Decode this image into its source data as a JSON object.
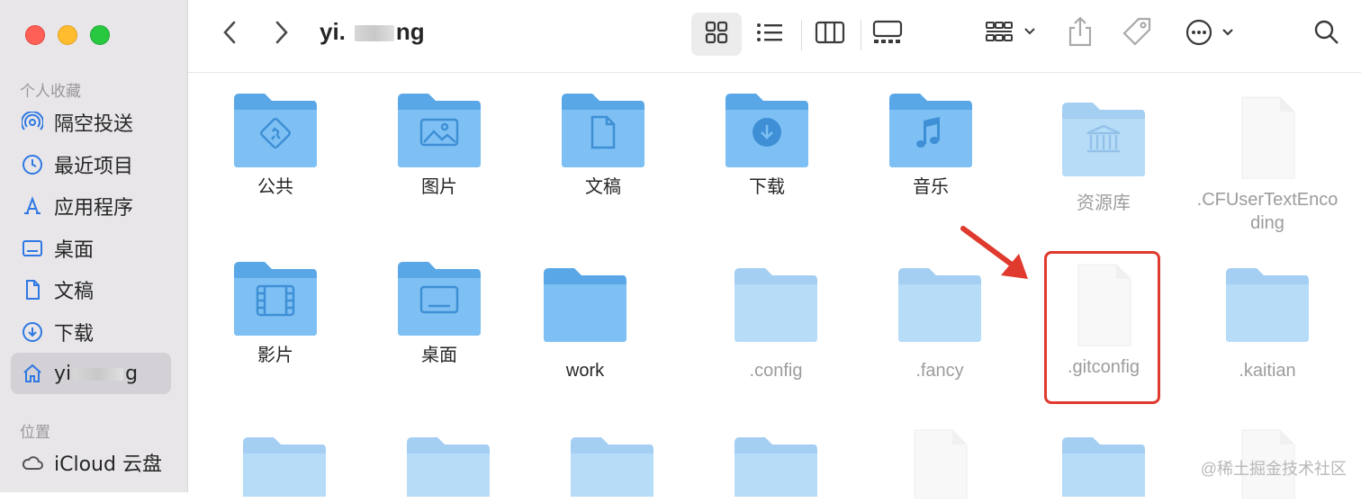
{
  "window": {
    "title_prefix": "yi.",
    "title_suffix": "ng"
  },
  "sidebar": {
    "favorites_label": "个人收藏",
    "favorites": [
      {
        "label": "隔空投送",
        "icon": "airdrop-icon"
      },
      {
        "label": "最近项目",
        "icon": "clock-icon"
      },
      {
        "label": "应用程序",
        "icon": "applications-icon"
      },
      {
        "label": "桌面",
        "icon": "desktop-icon"
      },
      {
        "label": "文稿",
        "icon": "document-icon"
      },
      {
        "label": "下载",
        "icon": "download-icon"
      },
      {
        "label_prefix": "yi",
        "label_suffix": "g",
        "icon": "home-icon",
        "active": true
      }
    ],
    "locations_label": "位置",
    "locations": [
      {
        "label": "iCloud 云盘",
        "icon": "cloud-icon"
      }
    ]
  },
  "toolbar": {
    "back": "back-icon",
    "forward": "forward-icon",
    "view_modes": [
      "icon-view-icon",
      "list-view-icon",
      "column-view-icon",
      "gallery-view-icon"
    ],
    "group": "group-icon",
    "share": "share-icon",
    "tag": "tag-icon",
    "more": "more-icon",
    "search": "search-icon"
  },
  "files": {
    "row1": [
      {
        "name": "公共",
        "type": "folder",
        "glyph": "public"
      },
      {
        "name": "图片",
        "type": "folder",
        "glyph": "pictures"
      },
      {
        "name": "文稿",
        "type": "folder",
        "glyph": "documents"
      },
      {
        "name": "下载",
        "type": "folder",
        "glyph": "downloads"
      },
      {
        "name": "音乐",
        "type": "folder",
        "glyph": "music"
      },
      {
        "name": "资源库",
        "type": "folder",
        "glyph": "library",
        "hidden": true
      },
      {
        "name_line1": ".CFUserTextEnco",
        "name_line2": "ding",
        "type": "file",
        "hidden": true
      }
    ],
    "row2": [
      {
        "name": "影片",
        "type": "folder",
        "glyph": "movies"
      },
      {
        "name": "桌面",
        "type": "folder",
        "glyph": "desktop"
      },
      {
        "name": "work",
        "type": "folder",
        "glyph": "none"
      },
      {
        "name": ".config",
        "type": "folder",
        "hidden": true
      },
      {
        "name": ".fancy",
        "type": "folder",
        "hidden": true
      },
      {
        "name": ".gitconfig",
        "type": "file",
        "hidden": true,
        "highlighted": true
      },
      {
        "name": ".kaitian",
        "type": "folder",
        "hidden": true
      }
    ]
  },
  "annotation": {
    "highlight_color": "#e03a2f"
  },
  "watermark": "@稀土掘金技术社区"
}
